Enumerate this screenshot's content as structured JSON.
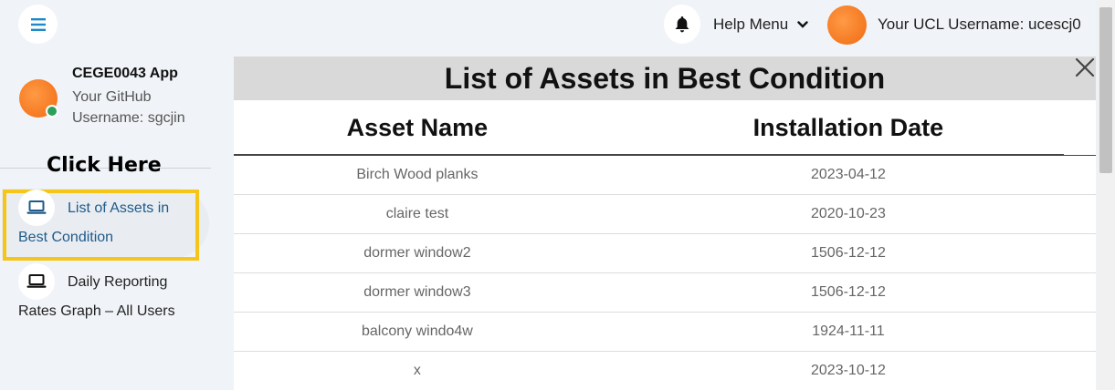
{
  "topbar": {
    "help_menu_label": "Help Menu",
    "user_label": "Your UCL Username: ucescj0"
  },
  "profile": {
    "app_name": "CEGE0043 App",
    "github_label": "Your GitHub Username: sgcjin"
  },
  "sidebar": {
    "hint": "Click Here",
    "items": [
      {
        "label": "List of Assets in Best Condition",
        "icon": "laptop-icon",
        "active": true
      },
      {
        "label": "Daily Reporting Rates Graph – All Users",
        "icon": "laptop-icon",
        "active": false
      }
    ]
  },
  "panel": {
    "title": "List of Assets in Best Condition",
    "columns": [
      "Asset Name",
      "Installation Date"
    ],
    "rows": [
      [
        "Birch Wood planks",
        "2023-04-12"
      ],
      [
        "claire test",
        "2020-10-23"
      ],
      [
        "dormer window2",
        "1506-12-12"
      ],
      [
        "dormer window3",
        "1506-12-12"
      ],
      [
        "balcony windo4w",
        "1924-11-11"
      ],
      [
        "x",
        "2023-10-12"
      ]
    ]
  },
  "colors": {
    "highlight": "#f5c518",
    "active_nav_text": "#1e5a8a",
    "menu_icon": "#1e88c8",
    "online_status": "#2ca05a"
  }
}
